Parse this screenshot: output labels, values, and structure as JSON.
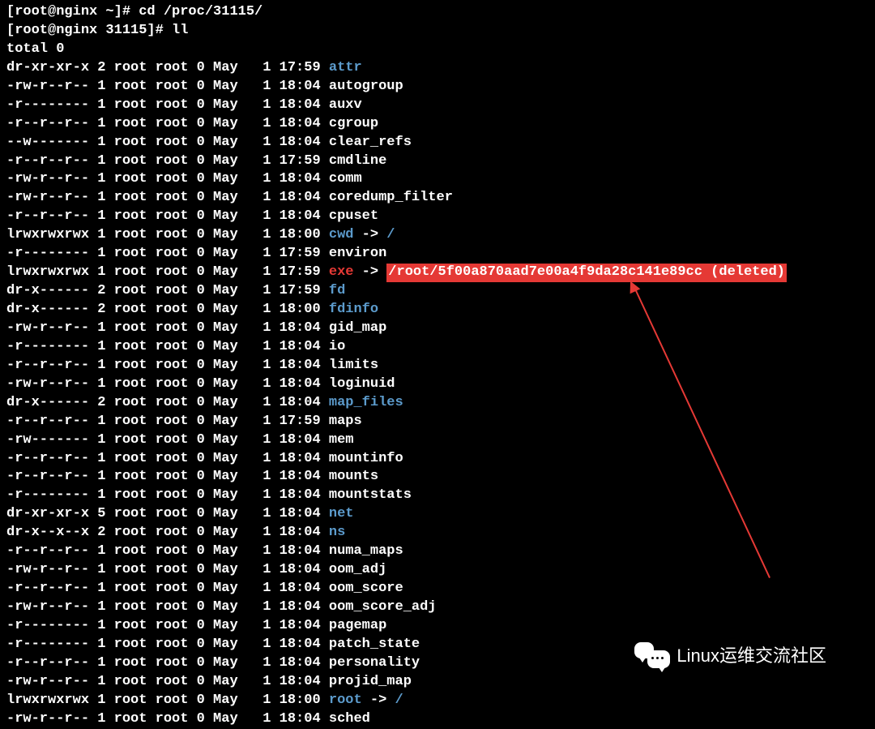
{
  "prompts": {
    "line1": "[root@nginx ~]# cd /proc/31115/",
    "line2": "[root@nginx 31115]# ll",
    "total": "total 0"
  },
  "entries": [
    {
      "perms": "dr-xr-xr-x",
      "links": "2",
      "owner": "root",
      "group": "root",
      "size": "0",
      "month": "May",
      "day": "  1",
      "time": "17:59",
      "name": "attr",
      "color": "blue",
      "link": ""
    },
    {
      "perms": "-rw-r--r--",
      "links": "1",
      "owner": "root",
      "group": "root",
      "size": "0",
      "month": "May",
      "day": "  1",
      "time": "18:04",
      "name": "autogroup",
      "color": "",
      "link": ""
    },
    {
      "perms": "-r--------",
      "links": "1",
      "owner": "root",
      "group": "root",
      "size": "0",
      "month": "May",
      "day": "  1",
      "time": "18:04",
      "name": "auxv",
      "color": "",
      "link": ""
    },
    {
      "perms": "-r--r--r--",
      "links": "1",
      "owner": "root",
      "group": "root",
      "size": "0",
      "month": "May",
      "day": "  1",
      "time": "18:04",
      "name": "cgroup",
      "color": "",
      "link": ""
    },
    {
      "perms": "--w-------",
      "links": "1",
      "owner": "root",
      "group": "root",
      "size": "0",
      "month": "May",
      "day": "  1",
      "time": "18:04",
      "name": "clear_refs",
      "color": "",
      "link": ""
    },
    {
      "perms": "-r--r--r--",
      "links": "1",
      "owner": "root",
      "group": "root",
      "size": "0",
      "month": "May",
      "day": "  1",
      "time": "17:59",
      "name": "cmdline",
      "color": "",
      "link": ""
    },
    {
      "perms": "-rw-r--r--",
      "links": "1",
      "owner": "root",
      "group": "root",
      "size": "0",
      "month": "May",
      "day": "  1",
      "time": "18:04",
      "name": "comm",
      "color": "",
      "link": ""
    },
    {
      "perms": "-rw-r--r--",
      "links": "1",
      "owner": "root",
      "group": "root",
      "size": "0",
      "month": "May",
      "day": "  1",
      "time": "18:04",
      "name": "coredump_filter",
      "color": "",
      "link": ""
    },
    {
      "perms": "-r--r--r--",
      "links": "1",
      "owner": "root",
      "group": "root",
      "size": "0",
      "month": "May",
      "day": "  1",
      "time": "18:04",
      "name": "cpuset",
      "color": "",
      "link": ""
    },
    {
      "perms": "lrwxrwxrwx",
      "links": "1",
      "owner": "root",
      "group": "root",
      "size": "0",
      "month": "May",
      "day": "  1",
      "time": "18:00",
      "name": "cwd",
      "color": "blue",
      "link": " -> ",
      "target": "/",
      "tcolor": "blue"
    },
    {
      "perms": "-r--------",
      "links": "1",
      "owner": "root",
      "group": "root",
      "size": "0",
      "month": "May",
      "day": "  1",
      "time": "17:59",
      "name": "environ",
      "color": "",
      "link": ""
    },
    {
      "perms": "lrwxrwxrwx",
      "links": "1",
      "owner": "root",
      "group": "root",
      "size": "0",
      "month": "May",
      "day": "  1",
      "time": "17:59",
      "name": "exe",
      "color": "red",
      "link": " -> ",
      "target": "/root/5f00a870aad7e00a4f9da28c141e89cc (deleted)",
      "tcolor": "highlight"
    },
    {
      "perms": "dr-x------",
      "links": "2",
      "owner": "root",
      "group": "root",
      "size": "0",
      "month": "May",
      "day": "  1",
      "time": "17:59",
      "name": "fd",
      "color": "blue",
      "link": ""
    },
    {
      "perms": "dr-x------",
      "links": "2",
      "owner": "root",
      "group": "root",
      "size": "0",
      "month": "May",
      "day": "  1",
      "time": "18:00",
      "name": "fdinfo",
      "color": "blue",
      "link": ""
    },
    {
      "perms": "-rw-r--r--",
      "links": "1",
      "owner": "root",
      "group": "root",
      "size": "0",
      "month": "May",
      "day": "  1",
      "time": "18:04",
      "name": "gid_map",
      "color": "",
      "link": ""
    },
    {
      "perms": "-r--------",
      "links": "1",
      "owner": "root",
      "group": "root",
      "size": "0",
      "month": "May",
      "day": "  1",
      "time": "18:04",
      "name": "io",
      "color": "",
      "link": ""
    },
    {
      "perms": "-r--r--r--",
      "links": "1",
      "owner": "root",
      "group": "root",
      "size": "0",
      "month": "May",
      "day": "  1",
      "time": "18:04",
      "name": "limits",
      "color": "",
      "link": ""
    },
    {
      "perms": "-rw-r--r--",
      "links": "1",
      "owner": "root",
      "group": "root",
      "size": "0",
      "month": "May",
      "day": "  1",
      "time": "18:04",
      "name": "loginuid",
      "color": "",
      "link": ""
    },
    {
      "perms": "dr-x------",
      "links": "2",
      "owner": "root",
      "group": "root",
      "size": "0",
      "month": "May",
      "day": "  1",
      "time": "18:04",
      "name": "map_files",
      "color": "blue",
      "link": ""
    },
    {
      "perms": "-r--r--r--",
      "links": "1",
      "owner": "root",
      "group": "root",
      "size": "0",
      "month": "May",
      "day": "  1",
      "time": "17:59",
      "name": "maps",
      "color": "",
      "link": ""
    },
    {
      "perms": "-rw-------",
      "links": "1",
      "owner": "root",
      "group": "root",
      "size": "0",
      "month": "May",
      "day": "  1",
      "time": "18:04",
      "name": "mem",
      "color": "",
      "link": ""
    },
    {
      "perms": "-r--r--r--",
      "links": "1",
      "owner": "root",
      "group": "root",
      "size": "0",
      "month": "May",
      "day": "  1",
      "time": "18:04",
      "name": "mountinfo",
      "color": "",
      "link": ""
    },
    {
      "perms": "-r--r--r--",
      "links": "1",
      "owner": "root",
      "group": "root",
      "size": "0",
      "month": "May",
      "day": "  1",
      "time": "18:04",
      "name": "mounts",
      "color": "",
      "link": ""
    },
    {
      "perms": "-r--------",
      "links": "1",
      "owner": "root",
      "group": "root",
      "size": "0",
      "month": "May",
      "day": "  1",
      "time": "18:04",
      "name": "mountstats",
      "color": "",
      "link": ""
    },
    {
      "perms": "dr-xr-xr-x",
      "links": "5",
      "owner": "root",
      "group": "root",
      "size": "0",
      "month": "May",
      "day": "  1",
      "time": "18:04",
      "name": "net",
      "color": "blue",
      "link": ""
    },
    {
      "perms": "dr-x--x--x",
      "links": "2",
      "owner": "root",
      "group": "root",
      "size": "0",
      "month": "May",
      "day": "  1",
      "time": "18:04",
      "name": "ns",
      "color": "blue",
      "link": ""
    },
    {
      "perms": "-r--r--r--",
      "links": "1",
      "owner": "root",
      "group": "root",
      "size": "0",
      "month": "May",
      "day": "  1",
      "time": "18:04",
      "name": "numa_maps",
      "color": "",
      "link": ""
    },
    {
      "perms": "-rw-r--r--",
      "links": "1",
      "owner": "root",
      "group": "root",
      "size": "0",
      "month": "May",
      "day": "  1",
      "time": "18:04",
      "name": "oom_adj",
      "color": "",
      "link": ""
    },
    {
      "perms": "-r--r--r--",
      "links": "1",
      "owner": "root",
      "group": "root",
      "size": "0",
      "month": "May",
      "day": "  1",
      "time": "18:04",
      "name": "oom_score",
      "color": "",
      "link": ""
    },
    {
      "perms": "-rw-r--r--",
      "links": "1",
      "owner": "root",
      "group": "root",
      "size": "0",
      "month": "May",
      "day": "  1",
      "time": "18:04",
      "name": "oom_score_adj",
      "color": "",
      "link": ""
    },
    {
      "perms": "-r--------",
      "links": "1",
      "owner": "root",
      "group": "root",
      "size": "0",
      "month": "May",
      "day": "  1",
      "time": "18:04",
      "name": "pagemap",
      "color": "",
      "link": ""
    },
    {
      "perms": "-r--------",
      "links": "1",
      "owner": "root",
      "group": "root",
      "size": "0",
      "month": "May",
      "day": "  1",
      "time": "18:04",
      "name": "patch_state",
      "color": "",
      "link": ""
    },
    {
      "perms": "-r--r--r--",
      "links": "1",
      "owner": "root",
      "group": "root",
      "size": "0",
      "month": "May",
      "day": "  1",
      "time": "18:04",
      "name": "personality",
      "color": "",
      "link": ""
    },
    {
      "perms": "-rw-r--r--",
      "links": "1",
      "owner": "root",
      "group": "root",
      "size": "0",
      "month": "May",
      "day": "  1",
      "time": "18:04",
      "name": "projid_map",
      "color": "",
      "link": ""
    },
    {
      "perms": "lrwxrwxrwx",
      "links": "1",
      "owner": "root",
      "group": "root",
      "size": "0",
      "month": "May",
      "day": "  1",
      "time": "18:00",
      "name": "root",
      "color": "blue",
      "link": " -> ",
      "target": "/",
      "tcolor": "blue"
    },
    {
      "perms": "-rw-r--r--",
      "links": "1",
      "owner": "root",
      "group": "root",
      "size": "0",
      "month": "May",
      "day": "  1",
      "time": "18:04",
      "name": "sched",
      "color": "",
      "link": ""
    }
  ],
  "watermark": {
    "text": "Linux运维交流社区"
  }
}
